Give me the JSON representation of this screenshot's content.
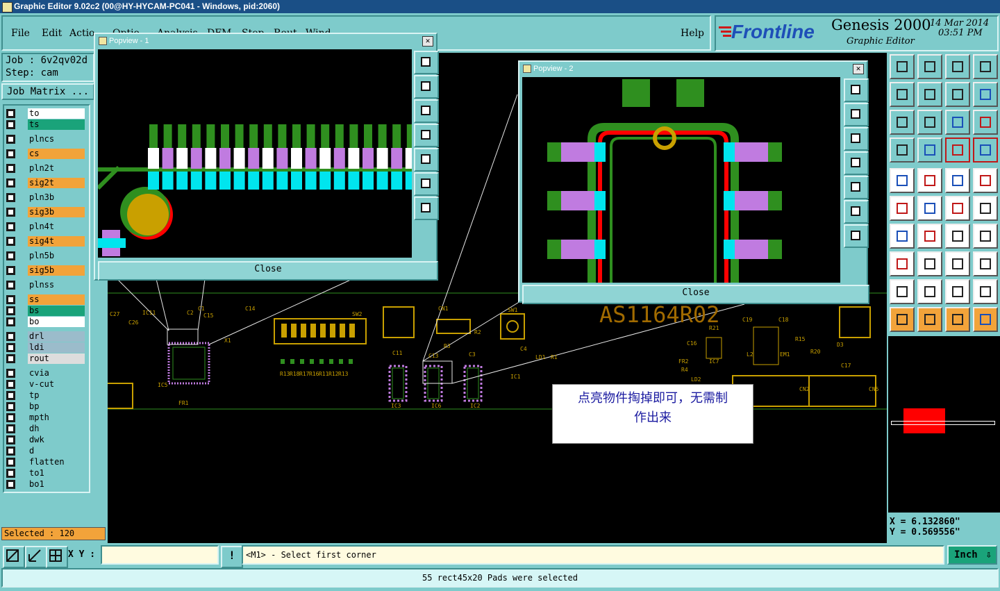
{
  "window": {
    "title": "Graphic Editor 9.02c2 (00@HY-HYCAM-PC041 - Windows, pid:2060)"
  },
  "menu": {
    "items": [
      "File",
      "Edit",
      "Actio",
      "Optio",
      "Analysis",
      "DFM",
      "Step",
      "Rout",
      "Wind"
    ],
    "help": "Help"
  },
  "brand": {
    "logo": "Frontline",
    "product": "Genesis 2000",
    "subtitle": "Graphic Editor",
    "date": "14 Mar 2014",
    "time": "03:51 PM"
  },
  "job": {
    "job_label": "Job : 6v2qv02d",
    "step_label": "Step: cam",
    "matrix_button": "Job Matrix ..."
  },
  "layers": [
    {
      "name": "to",
      "color": "#ffffff"
    },
    {
      "name": "ts",
      "color": "#1aa37a"
    },
    {
      "name": "plncs",
      "color": "#7ecbcb"
    },
    {
      "name": "cs",
      "color": "#f2a33a"
    },
    {
      "name": "pln2t",
      "color": "#7ecbcb"
    },
    {
      "name": "sig2t",
      "color": "#f2a33a"
    },
    {
      "name": "pln3b",
      "color": "#7ecbcb"
    },
    {
      "name": "sig3b",
      "color": "#f2a33a"
    },
    {
      "name": "pln4t",
      "color": "#7ecbcb"
    },
    {
      "name": "sig4t",
      "color": "#f2a33a"
    },
    {
      "name": "pln5b",
      "color": "#7ecbcb"
    },
    {
      "name": "sig5b",
      "color": "#f2a33a"
    },
    {
      "name": "plnss",
      "color": "#7ecbcb"
    },
    {
      "name": "ss",
      "color": "#f2a33a"
    },
    {
      "name": "bs",
      "color": "#1aa37a"
    },
    {
      "name": "bo",
      "color": "#ffffff"
    },
    {
      "name": "drl",
      "color": "#9bbccb"
    },
    {
      "name": "ldi",
      "color": "#9bbccb"
    },
    {
      "name": "rout",
      "color": "#dddddd"
    },
    {
      "name": "cvia",
      "color": "#7ecbcb"
    },
    {
      "name": "v-cut",
      "color": "#7ecbcb"
    },
    {
      "name": "tp",
      "color": "#7ecbcb"
    },
    {
      "name": "bp",
      "color": "#7ecbcb"
    },
    {
      "name": "mpth",
      "color": "#7ecbcb"
    },
    {
      "name": "dh",
      "color": "#7ecbcb"
    },
    {
      "name": "dwk",
      "color": "#7ecbcb"
    },
    {
      "name": "d",
      "color": "#7ecbcb"
    },
    {
      "name": "flatten",
      "color": "#7ecbcb"
    },
    {
      "name": "to1",
      "color": "#7ecbcb"
    },
    {
      "name": "bo1",
      "color": "#7ecbcb"
    }
  ],
  "selected": "Selected : 120",
  "popview1": {
    "title": "Popview - 1",
    "close_label": "Close"
  },
  "popview2": {
    "title": "Popview - 2",
    "close_label": "Close"
  },
  "board": {
    "part_number": "AS1164R02",
    "refdes": [
      "C27",
      "C26",
      "IC11",
      "C2",
      "C1",
      "C15",
      "C14",
      "X1",
      "IC5",
      "FR1",
      "SW2",
      "SW1",
      "CN1",
      "R2",
      "R3",
      "C4",
      "R13",
      "R18",
      "R17",
      "R16",
      "R11",
      "R12",
      "R13",
      "C11",
      "C13",
      "C3",
      "LD1",
      "R1",
      "IC1",
      "IC3",
      "IC6",
      "IC2",
      "R21",
      "C19",
      "C18",
      "C16",
      "IC7",
      "FR2",
      "R4",
      "LD2",
      "R15",
      "R20",
      "D3",
      "C17",
      "EM1",
      "L2",
      "CN2",
      "CN5"
    ]
  },
  "annotation": {
    "line1": "点亮物件掏掉即可，无需制",
    "line2": "作出来"
  },
  "coords": {
    "x": "X = 6.132860\"",
    "y": "Y = 0.569556\""
  },
  "bottom": {
    "xy_label": "X Y :",
    "xy_value": "",
    "prompt": "<M1> - Select first corner",
    "units": "Inch",
    "status": "55 rect45x20 Pads were selected"
  },
  "colors": {
    "canvas_bg": "#000000",
    "ui_bg": "#7ecbcb",
    "copper_green": "#2f8f1f",
    "pad_violet": "#c07be0",
    "pad_cyan": "#00e5ee",
    "trace_red": "#ff0000",
    "silk_yellow": "#c9a000"
  }
}
